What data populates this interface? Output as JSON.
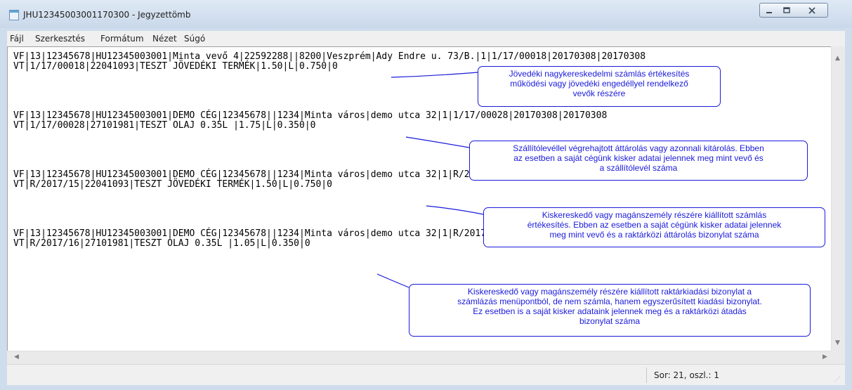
{
  "window": {
    "title": "JHU12345003001170300 - Jegyzettömb"
  },
  "menu": [
    "Fájl",
    "Szerkesztés",
    "Formátum",
    "Nézet",
    "Súgó"
  ],
  "content": {
    "lines": [
      "VF|13|12345678|HU12345003001|Minta vevő 4|22592288||8200|Veszprém|Ady Endre u. 73/B.|1|1/17/00018|20170308|20170308",
      "VT|1/17/00018|22041093|TESZT JÖVEDÉKI TERMÉK|1.50|L|0.750|0",
      "",
      "",
      "",
      "",
      "VF|13|12345678|HU12345003001|DEMO CÉG|12345678||1234|Minta város|demo utca 32|1|1/17/00028|20170308|20170308",
      "VT|1/17/00028|27101981|TESZT OLAJ 0.35L |1.75|L|0.350|0",
      "",
      "",
      "",
      "",
      "VF|13|12345678|HU12345003001|DEMO CÉG|12345678||1234|Minta város|demo utca 32|1|R/2017/15|20170308|20170308",
      "VT|R/2017/15|22041093|TESZT JÖVEDÉKI TERMÉK|1.50|L|0.750|0",
      "",
      "",
      "",
      "",
      "VF|13|12345678|HU12345003001|DEMO CÉG|12345678||1234|Minta város|demo utca 32|1|R/2017/16|20170308|20170308",
      "VT|R/2017/16|27101981|TESZT OLAJ 0.35L |1.05|L|0.350|0"
    ]
  },
  "annotations": [
    {
      "lines": [
        "Jövedéki nagykereskedelmi számlás értékesítés",
        "működési vagy jövedéki engedéllyel rendelkező",
        "vevők részére"
      ]
    },
    {
      "lines": [
        "Szállítólevéllel végrehajtott áttárolás vagy azonnali kitárolás. Ebben",
        "az esetben a saját cégünk kisker adatai jelennek meg mint vevő és",
        "a szállítólevél száma"
      ]
    },
    {
      "lines": [
        "Kiskereskedő vagy magánszemély részére kiállított számlás",
        "értékesítés. Ebben az esetben a saját cégünk kisker adatai jelennek",
        "meg mint vevő és a raktárközi áttárolás bizonylat száma"
      ]
    },
    {
      "lines": [
        "Kiskereskedő vagy magánszemély részére kiállított raktárkiadási bizonylat a",
        "számlázás menüpontból, de nem számla, hanem egyszerűsített kiadási bizonylat.",
        "Ez esetben is a saját kisker adataink jelennek meg és a raktárközi átadás",
        "bizonylat száma"
      ]
    }
  ],
  "status": {
    "position": "Sor: 21, oszl.: 1"
  },
  "colors": {
    "annotation": "#1a1adb"
  }
}
